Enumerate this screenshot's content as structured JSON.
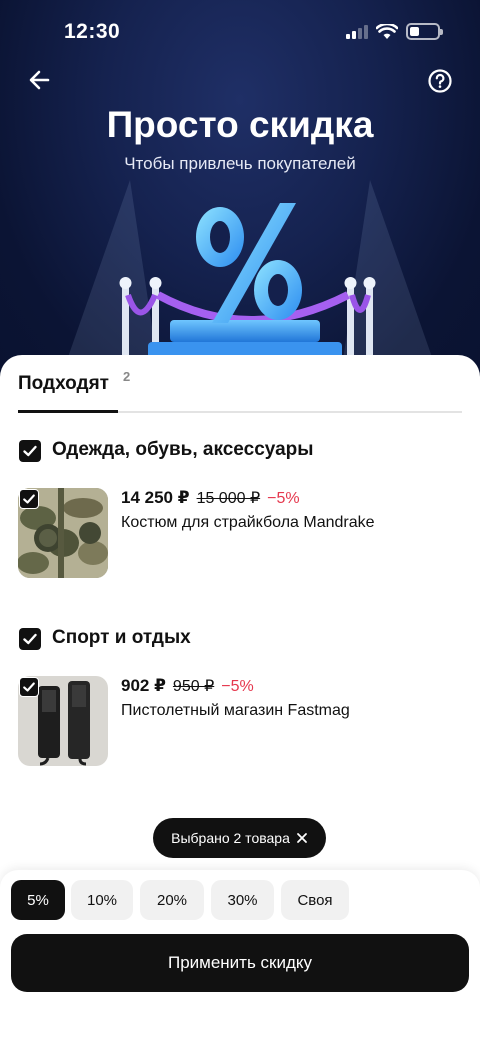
{
  "status_bar": {
    "time": "12:30",
    "battery_level": 0.2
  },
  "header": {
    "title": "Просто скидка",
    "subtitle": "Чтобы привлечь покупателей",
    "back_icon": "arrow-left-icon",
    "help_icon": "question-circle-icon"
  },
  "tabs": [
    {
      "label": "Подходят",
      "count": "2",
      "active": true
    }
  ],
  "categories": [
    {
      "title": "Одежда, обувь, аксессуары",
      "checked": true,
      "products": [
        {
          "price": "14 250 ₽",
          "old_price": "15 000 ₽",
          "discount": "−5%",
          "name": "Костюм для страйкбола Mandrake",
          "checked": true
        }
      ]
    },
    {
      "title": "Спорт и отдых",
      "checked": true,
      "products": [
        {
          "price": "902 ₽",
          "old_price": "950 ₽",
          "discount": "−5%",
          "name": "Пистолетный магазин Fastmag",
          "checked": true
        }
      ]
    }
  ],
  "selection": {
    "label": "Выбрано 2 товара"
  },
  "discount_options": [
    {
      "label": "5%",
      "selected": true
    },
    {
      "label": "10%",
      "selected": false
    },
    {
      "label": "20%",
      "selected": false
    },
    {
      "label": "30%",
      "selected": false
    },
    {
      "label": "Своя",
      "selected": false
    }
  ],
  "apply_button": {
    "label": "Применить скидку"
  },
  "colors": {
    "accent_dark": "#111111",
    "discount_red": "#e5384e",
    "hero_bg": "#14204c"
  }
}
